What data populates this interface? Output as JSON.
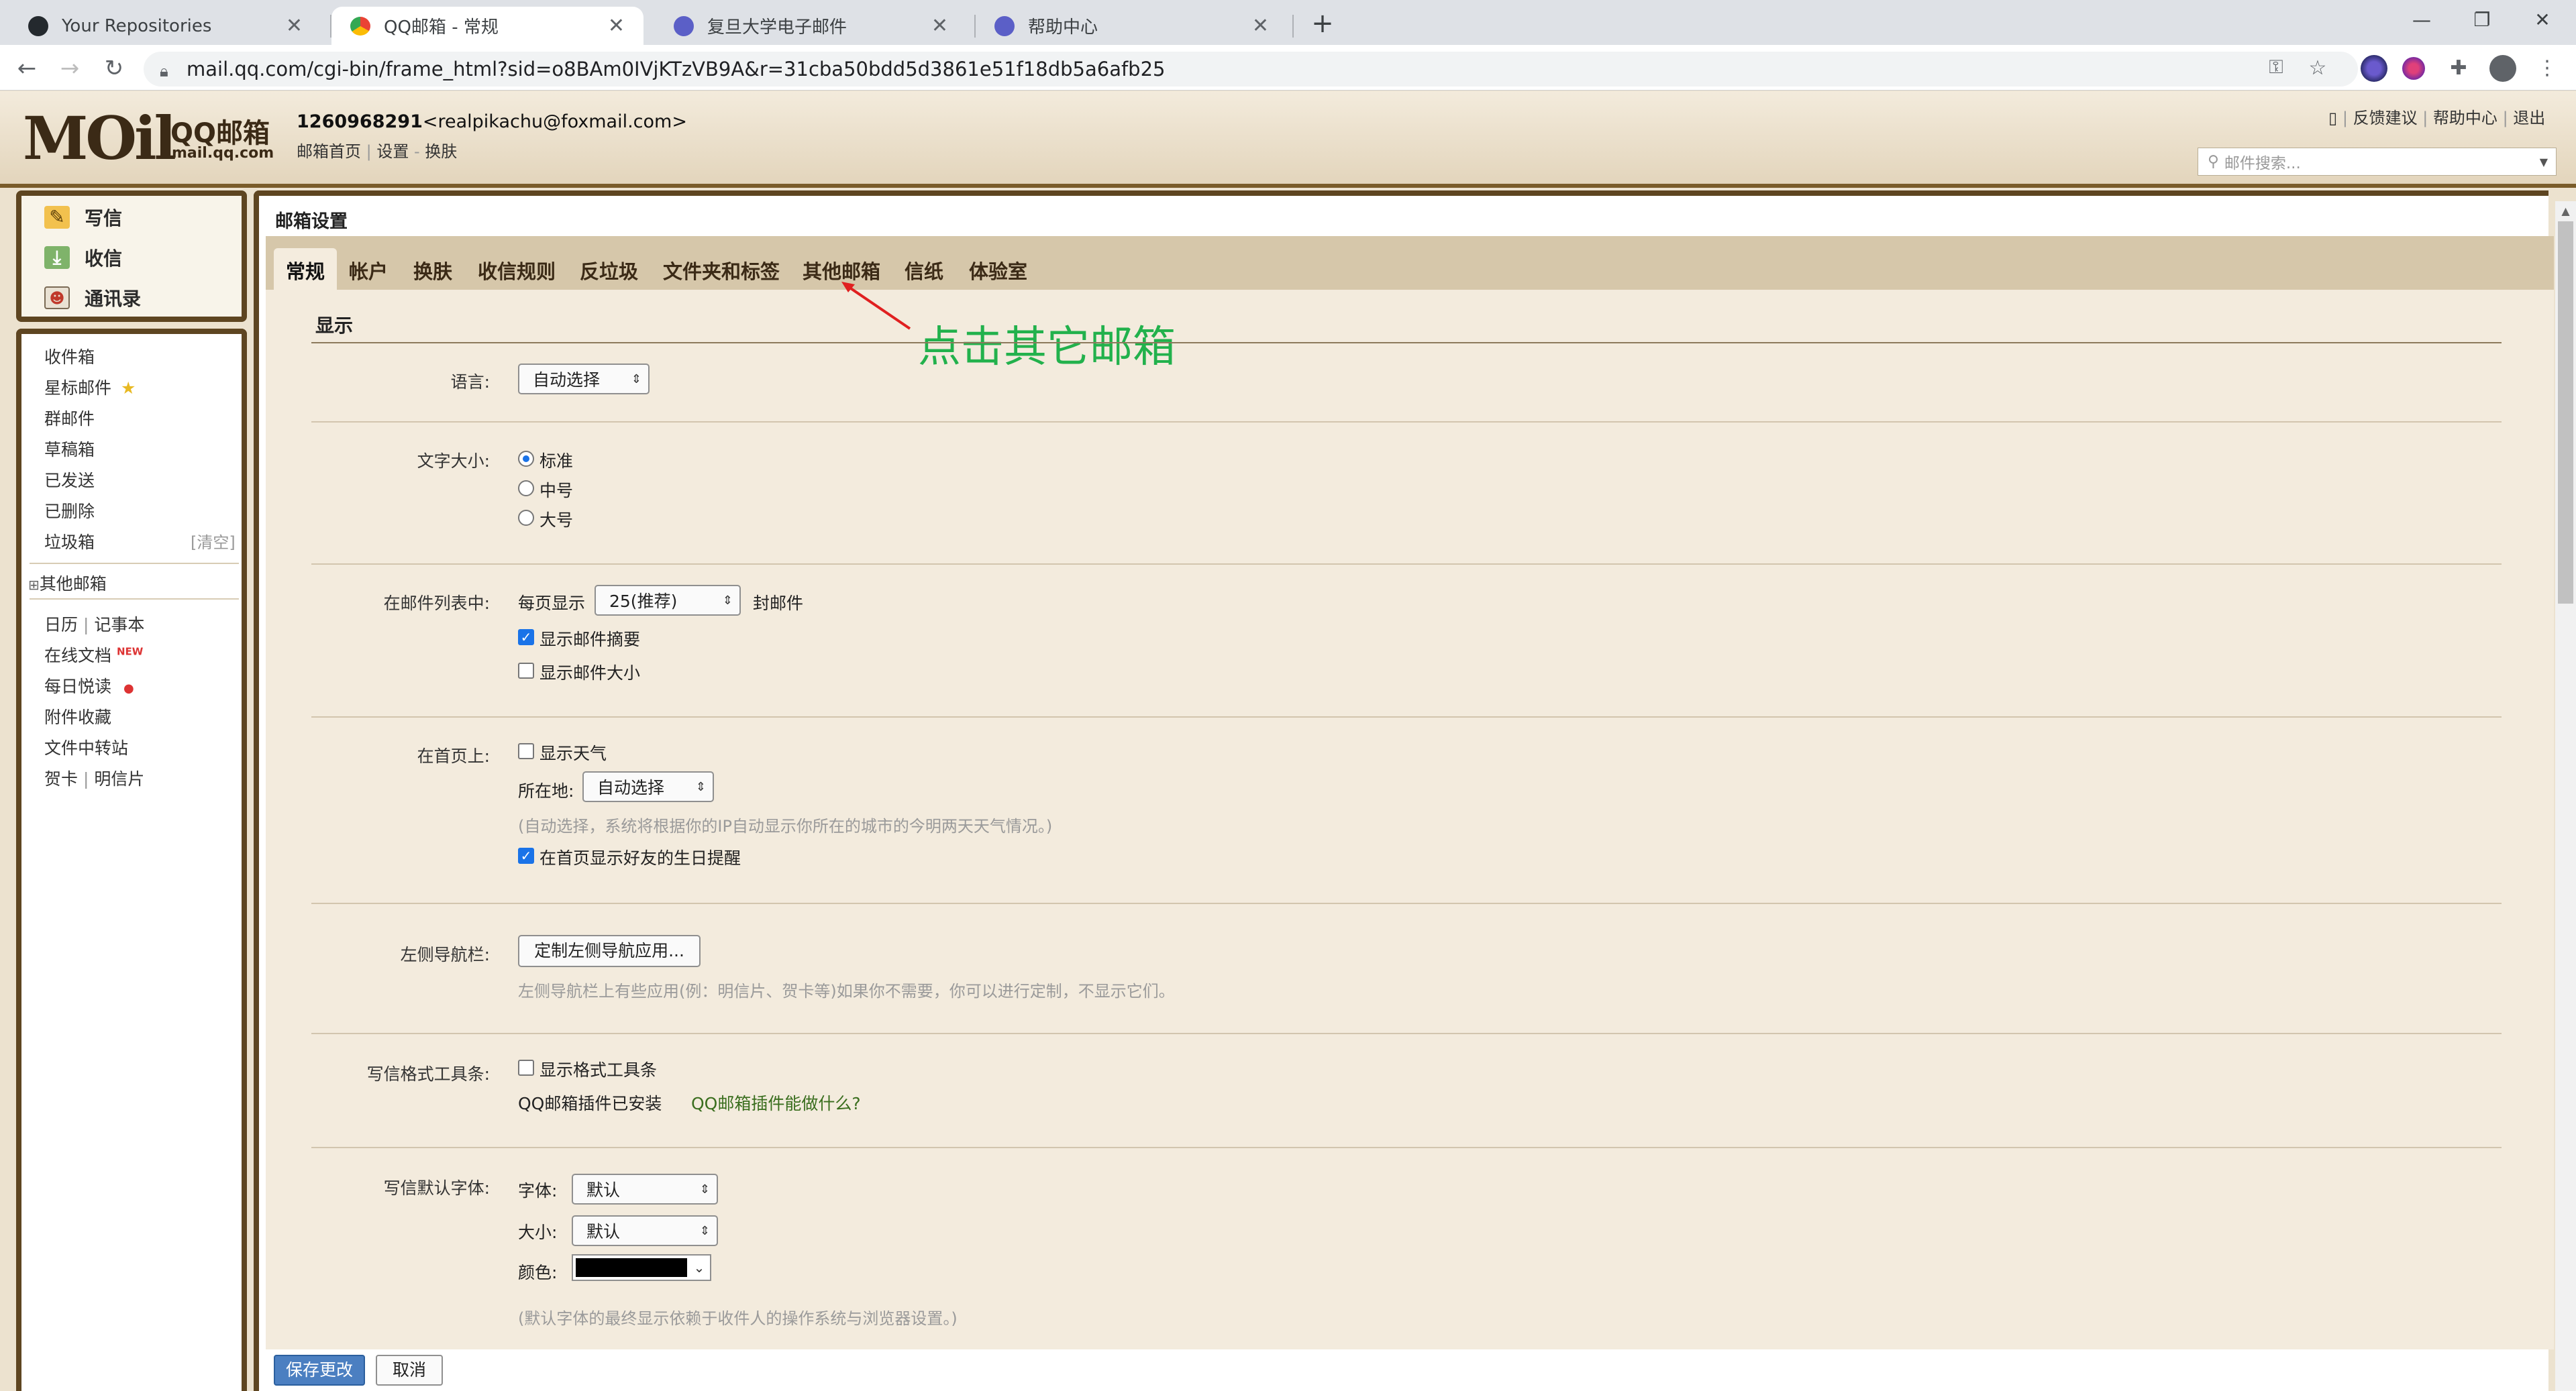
{
  "browser": {
    "tabs": [
      {
        "label": "Your Repositories",
        "icon": "github-icon",
        "active": false
      },
      {
        "label": "QQ邮箱 - 常规",
        "icon": "qq-mail-icon",
        "active": true
      },
      {
        "label": "复旦大学电子邮件",
        "icon": "globe-icon",
        "active": false
      },
      {
        "label": "帮助中心",
        "icon": "globe-icon",
        "active": false
      }
    ],
    "new_tab": "+",
    "url": "mail.qq.com/cgi-bin/frame_html?sid=o8BAm0IVjKTzVB9A&r=31cba50bdd5d3861e51f18db5a6afb25",
    "controls": {
      "minimize": "—",
      "restore": "❐",
      "close": "✕"
    }
  },
  "header": {
    "logo_main": "MOil",
    "logo_brand": "QQ邮箱",
    "logo_domain": "mail.qq.com",
    "account_number": "1260968291",
    "account_email": "<realpikachu@foxmail.com>",
    "account_links": [
      "邮箱首页",
      "设置",
      "换肤"
    ],
    "top_links": [
      "反馈建议",
      "帮助中心",
      "退出"
    ],
    "search_placeholder": "邮件搜索..."
  },
  "sidebar": {
    "actions": [
      {
        "label": "写信",
        "icon": "compose-icon"
      },
      {
        "label": "收信",
        "icon": "inbox-download-icon"
      },
      {
        "label": "通讯录",
        "icon": "contacts-icon"
      }
    ],
    "folders": [
      "收件箱",
      "星标邮件",
      "群邮件",
      "草稿箱",
      "已发送",
      "已删除",
      "垃圾箱"
    ],
    "trash_clear": "[清空]",
    "other_mailboxes": "其他邮箱",
    "tools": {
      "calendar": "日历",
      "notes": "记事本",
      "docs": "在线文档",
      "docs_badge": "NEW",
      "daily": "每日悦读",
      "attachments": "附件收藏",
      "transfer": "文件中转站",
      "greeting": "贺卡",
      "postcard": "明信片"
    }
  },
  "settings": {
    "title": "邮箱设置",
    "tabs": [
      "常规",
      "帐户",
      "换肤",
      "收信规则",
      "反垃圾",
      "文件夹和标签",
      "其他邮箱",
      "信纸",
      "体验室"
    ],
    "active_tab": "常规",
    "annotation": "点击其它邮箱",
    "section_title": "显示",
    "language": {
      "label": "语言:",
      "value": "自动选择"
    },
    "font_size": {
      "label": "文字大小:",
      "options": [
        "标准",
        "中号",
        "大号"
      ],
      "selected": "标准"
    },
    "mail_list": {
      "label": "在邮件列表中:",
      "per_page_prefix": "每页显示",
      "per_page_value": "25(推荐)",
      "per_page_suffix": "封邮件",
      "show_summary": "显示邮件摘要",
      "show_size": "显示邮件大小"
    },
    "home": {
      "label": "在首页上:",
      "show_weather": "显示天气",
      "location_label": "所在地:",
      "location_value": "自动选择",
      "location_hint": "(自动选择，系统将根据你的IP自动显示你所在的城市的今明两天天气情况。)",
      "birthday": "在首页显示好友的生日提醒"
    },
    "left_nav": {
      "label": "左侧导航栏:",
      "button": "定制左侧导航应用...",
      "hint": "左侧导航栏上有些应用(例：明信片、贺卡等)如果你不需要，你可以进行定制，不显示它们。"
    },
    "toolbar": {
      "label": "写信格式工具条:",
      "show": "显示格式工具条",
      "plugin_installed": "QQ邮箱插件已安装",
      "plugin_link": "QQ邮箱插件能做什么?"
    },
    "default_font": {
      "label": "写信默认字体:",
      "font_label": "字体:",
      "font_value": "默认",
      "size_label": "大小:",
      "size_value": "默认",
      "color_label": "颜色:",
      "hint": "(默认字体的最终显示依赖于收件人的操作系统与浏览器设置。)"
    },
    "save_button": "保存更改",
    "cancel_button": "取消"
  },
  "colors": {
    "header_brown": "#5e4521",
    "tab_strip": "#d6c7aa",
    "content_bg": "#f3ebdd",
    "annotation_green": "#22b14c",
    "save_blue": "#4b7fc1"
  }
}
